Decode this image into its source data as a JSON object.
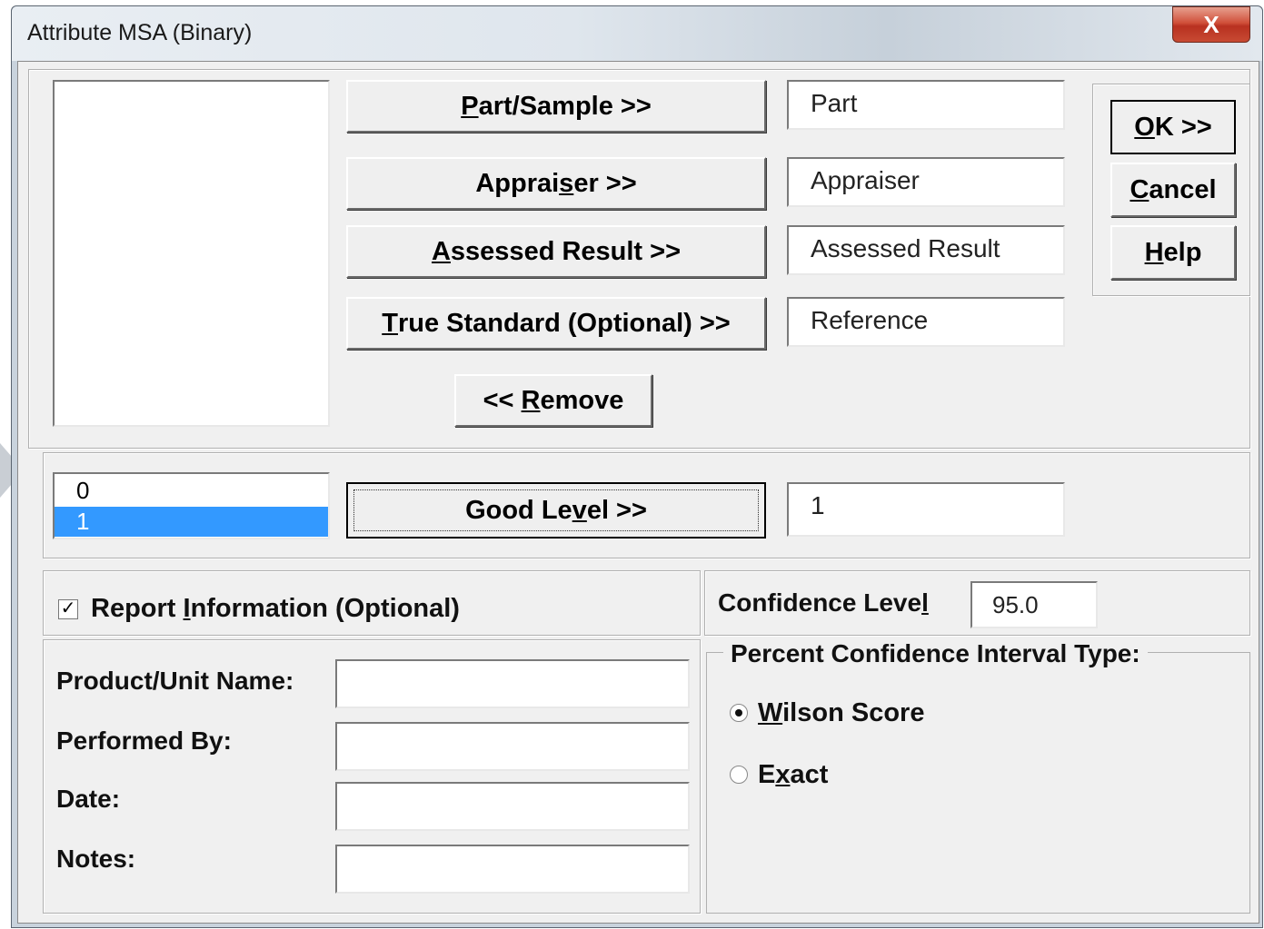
{
  "window": {
    "title": "Attribute MSA (Binary)",
    "close_glyph": "X"
  },
  "variables_list": {
    "items": []
  },
  "assign_buttons": [
    {
      "before": "",
      "key": "P",
      "after": "art/Sample  >>",
      "field_value": "Part"
    },
    {
      "before": "Apprai",
      "key": "s",
      "after": "er >>",
      "field_value": "Appraiser"
    },
    {
      "before": "",
      "key": "A",
      "after": "ssessed Result  >>",
      "field_value": "Assessed Result"
    },
    {
      "before": "",
      "key": "T",
      "after": "rue Standard (Optional) >>",
      "field_value": "Reference"
    }
  ],
  "remove_button": {
    "before": "<< ",
    "key": "R",
    "after": "emove"
  },
  "levels_list": {
    "items": [
      "0",
      "1"
    ],
    "selected_index": 1
  },
  "good_level": {
    "before": "Good Le",
    "key": "v",
    "after": "el >>",
    "field_value": "1"
  },
  "dialog_buttons": {
    "ok": {
      "before": "",
      "key": "O",
      "after": "K >>"
    },
    "cancel": {
      "before": "",
      "key": "C",
      "after": "ancel"
    },
    "help": {
      "before": "",
      "key": "H",
      "after": "elp"
    }
  },
  "report": {
    "checked": true,
    "check_glyph": "✓",
    "label_before": "Report ",
    "label_key": "I",
    "label_after": "nformation (Optional)",
    "fields": [
      {
        "label": "Product/Unit Name:",
        "value": ""
      },
      {
        "label": "Performed By:",
        "value": ""
      },
      {
        "label": "Date:",
        "value": ""
      },
      {
        "label": "Notes:",
        "value": ""
      }
    ]
  },
  "confidence": {
    "label_before": "Confidence Leve",
    "label_key": "l",
    "label_after": "",
    "value": "95.0"
  },
  "interval_type": {
    "legend": "Percent Confidence Interval Type:",
    "options": [
      {
        "before": "",
        "key": "W",
        "after": "ilson Score",
        "selected": true
      },
      {
        "before": "E",
        "key": "x",
        "after": "act",
        "selected": false
      }
    ]
  }
}
